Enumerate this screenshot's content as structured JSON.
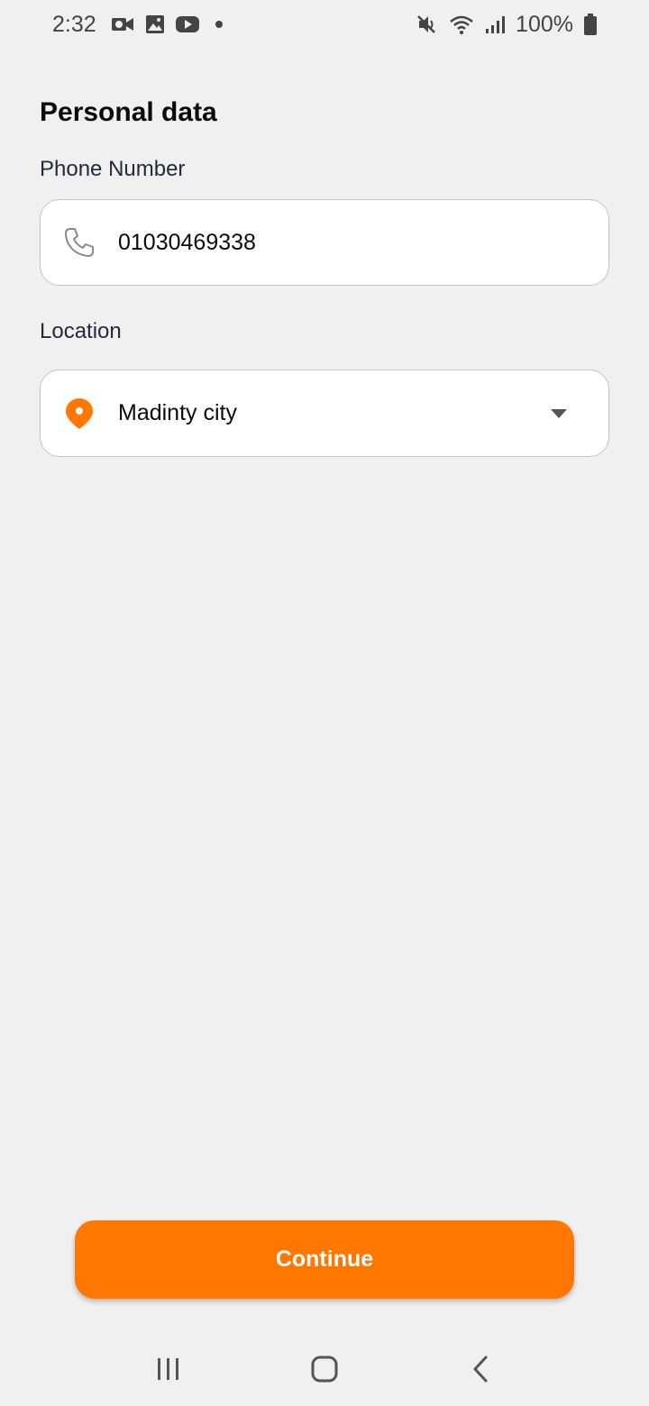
{
  "status_bar": {
    "time": "2:32",
    "battery": "100%",
    "icons_left": [
      "screen-record-icon",
      "gallery-icon",
      "youtube-icon",
      "notification-dot"
    ],
    "icons_right": [
      "mute-icon",
      "wifi-icon",
      "signal-icon",
      "battery-icon"
    ]
  },
  "page": {
    "title": "Personal data"
  },
  "phone": {
    "label": "Phone Number",
    "value": "01030469338",
    "icon": "phone-icon"
  },
  "location": {
    "label": "Location",
    "value": "Madinty city",
    "icon": "location-pin-icon",
    "dropdown_icon": "dropdown-arrow-icon"
  },
  "actions": {
    "continue_label": "Continue"
  },
  "nav": {
    "items": [
      "recent-apps-icon",
      "home-icon",
      "back-icon"
    ]
  },
  "colors": {
    "accent": "#ff7700",
    "background": "#f0f0f0",
    "field_border": "#c4c4c4"
  }
}
